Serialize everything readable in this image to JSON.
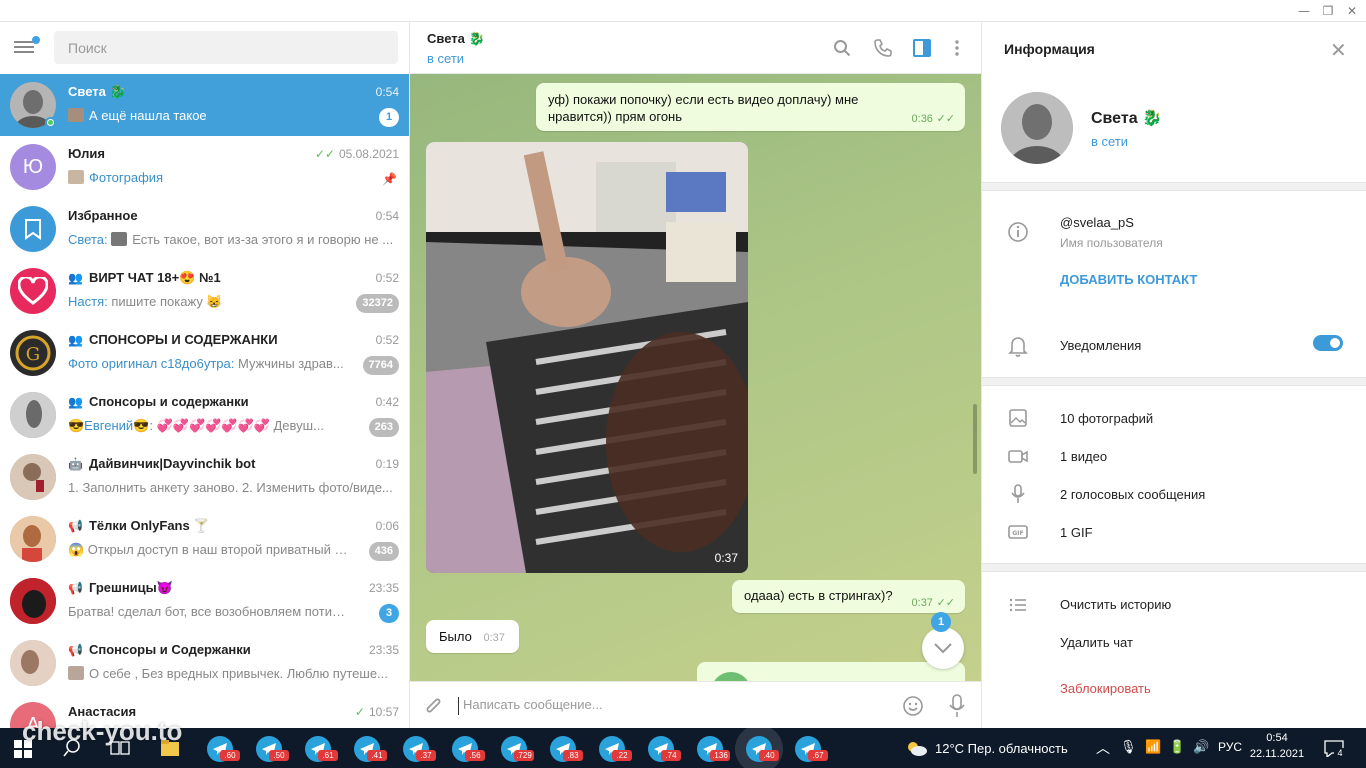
{
  "search": {
    "placeholder": "Поиск"
  },
  "chats": [
    {
      "title": "Света 🐉",
      "time": "0:54",
      "preview": "А ещё нашла такое",
      "badge": "1",
      "avatar_color": "#888888"
    },
    {
      "title": "Юлия",
      "time": "05.08.2021",
      "preview": "Фотография",
      "initial": "Ю",
      "avatar_color": "#a58be0"
    },
    {
      "title": "Избранное",
      "time": "0:54",
      "sender": "Света:",
      "preview": "Есть такое, вот из-за этого я и говорю не ...",
      "avatar_color": "#3d9ad8"
    },
    {
      "title": "ВИРТ ЧАТ 18+😍 №1",
      "time": "0:52",
      "sender": "Настя:",
      "preview": "пишите покажу 😸",
      "badge": "32372",
      "avatar_color": "#e8295d"
    },
    {
      "title": "СПОНСОРЫ И СОДЕРЖАНКИ",
      "time": "0:52",
      "sender": "Фото оригинал с18до6утра:",
      "preview": "Мужчины здрав...",
      "badge": "7764",
      "avatar_color": "#2b2b2b"
    },
    {
      "title": "Спонсоры и содержанки",
      "time": "0:42",
      "sender": "😎Евгений😎:",
      "preview": "💞💞💞💞💞💞💞 Девуш...",
      "badge": "263",
      "avatar_color": "#9c9c9c"
    },
    {
      "title": "Дайвинчик|Dayvinchik bot",
      "time": "0:19",
      "preview": "1. Заполнить анкету заново. 2. Изменить фото/виде...",
      "avatar_color": "#b9a08a"
    },
    {
      "title": "Тёлки OnlyFans 🍸",
      "time": "0:06",
      "preview": "😱 Открыл доступ в наш второй приватный к...",
      "badge": "436",
      "avatar_color": "#d08a5e"
    },
    {
      "title": "Грешницы😈",
      "time": "23:35",
      "preview": "Братва! сделал бот, все возобновляем потихонь...",
      "badge": "3",
      "avatar_color": "#c0232b"
    },
    {
      "title": "Спонсоры и Содержанки",
      "time": "23:35",
      "preview": "О себе ,  Без вредных привычек.  Люблю путеше...",
      "avatar_color": "#c9a995"
    },
    {
      "title": "Анастасия",
      "time": "10:57",
      "preview": "",
      "initial": "А",
      "avatar_color": "#e86b7a"
    }
  ],
  "watermark": "check-you.to",
  "conversation": {
    "name": "Света 🐉",
    "status": "в сети",
    "msg1_text": "уф) покажи попочку) если есть видео доплачу) мне нравится)) прям огонь",
    "msg1_time": "0:36",
    "photo_time": "0:37",
    "msg2_text": "одааа) есть в стрингах)?",
    "msg2_time": "0:37",
    "msg3_text": "Было",
    "msg3_time": "0:37",
    "unread_count": "1",
    "composer_placeholder": "Написать сообщение..."
  },
  "info": {
    "title": "Информация",
    "name": "Света 🐉",
    "status": "в сети",
    "username": "@svelaa_pS",
    "username_label": "Имя пользователя",
    "add_contact": "ДОБАВИТЬ КОНТАКТ",
    "notifications": "Уведомления",
    "notifications_on": true,
    "photos": "10 фотографий",
    "videos": "1 видео",
    "voice": "2 голосовых сообщения",
    "gifs": "1 GIF",
    "clear_history": "Очистить историю",
    "delete_chat": "Удалить чат",
    "block": "Заблокировать"
  },
  "taskbar": {
    "apps": [
      ".60",
      ".50",
      ".61",
      ".41",
      ".37",
      ".56",
      ".729",
      ".83",
      ".22",
      ".74",
      ".136",
      ".40",
      ".67"
    ],
    "weather": "12°C  Пер. облачность",
    "lang": "РУС",
    "time": "0:54",
    "date": "22.11.2021",
    "notif_count": "4"
  },
  "colors": {
    "accent": "#419fd9",
    "bubble_out": "#effdde",
    "taskbar": "#0e1a29"
  }
}
